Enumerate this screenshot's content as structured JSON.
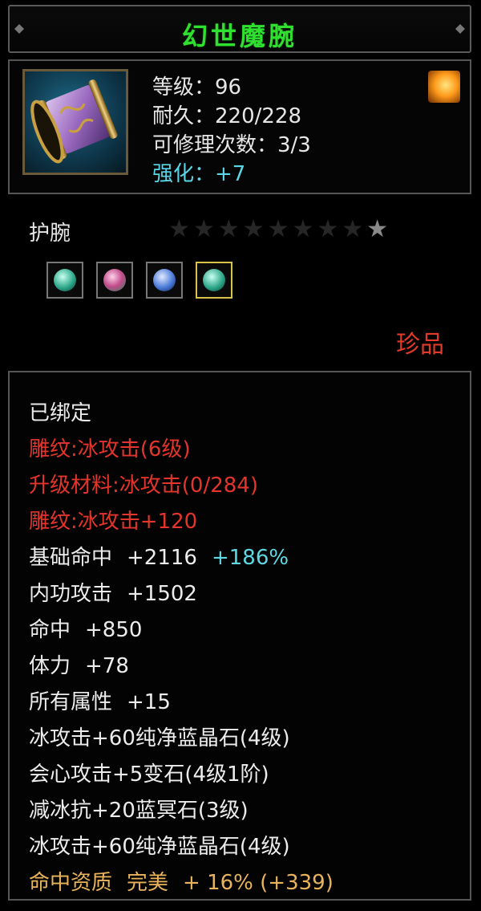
{
  "item": {
    "name": "幻世魔腕",
    "stats": [
      {
        "label": "等级：96"
      },
      {
        "label": "耐久：220/228"
      },
      {
        "label": "可修理次数：3/3"
      },
      {
        "label": "强化：+7"
      }
    ],
    "type": "护腕",
    "stars": {
      "total": 9,
      "lit": 1
    },
    "gems": [
      "jade-gem",
      "ruby-gem",
      "sapphire-gem",
      "jade-gem"
    ],
    "rarity": "珍品"
  },
  "attributes": {
    "bound": "已绑定",
    "engrave1": "雕纹:冰攻击(6级)",
    "upgrade_material": "升级材料:冰攻击(0/284)",
    "engrave2": "雕纹:冰攻击+120",
    "hit_base_label": "基础命中",
    "hit_base_value": "+2116",
    "hit_base_pct": "+186%",
    "inner_attack_label": "内功攻击",
    "inner_attack_value": "+1502",
    "hit_label": "命中",
    "hit_value": "+850",
    "stamina_label": "体力",
    "stamina_value": "+78",
    "all_attr_label": "所有属性",
    "all_attr_value": "+15",
    "gem1": "冰攻击+60纯净蓝晶石(4级)",
    "gem2": "会心攻击+5变石(4级1阶)",
    "gem3": "减冰抗+20蓝冥石(3级)",
    "gem4": "冰攻击+60纯净蓝晶石(4级)",
    "aptitude_label": "命中资质",
    "aptitude_grade": "完美",
    "aptitude_value": "+ 16% (+339)"
  },
  "colors": {
    "title": "#2fe02f",
    "red": "#e3352b",
    "cyan": "#5fd8e4",
    "gold": "#e8b35a"
  }
}
